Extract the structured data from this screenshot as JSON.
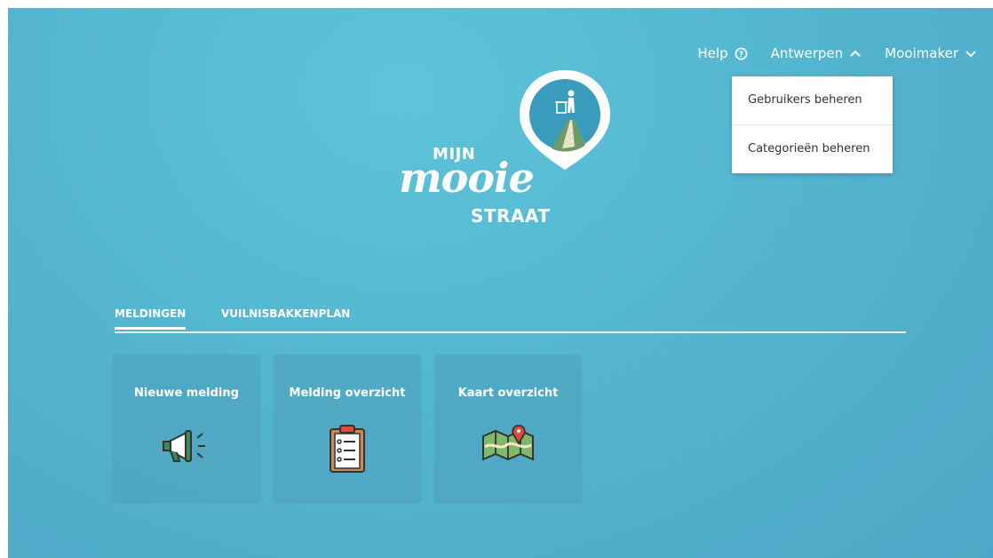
{
  "nav": {
    "help_label": "Help",
    "city_label": "Antwerpen",
    "user_label": "Mooimaker"
  },
  "dropdown": {
    "items": [
      "Gebruikers beheren",
      "Categorieën beheren"
    ]
  },
  "logo": {
    "line1": "MIJN",
    "line2": "mooie",
    "line3": "STRAAT"
  },
  "tabs": [
    {
      "label": "MELDINGEN",
      "active": true
    },
    {
      "label": "VUILNISBAKKENPLAN",
      "active": false
    }
  ],
  "cards": [
    {
      "title": "Nieuwe melding",
      "icon": "megaphone-icon"
    },
    {
      "title": "Melding overzicht",
      "icon": "clipboard-icon"
    },
    {
      "title": "Kaart overzicht",
      "icon": "map-icon"
    }
  ],
  "colors": {
    "background": "#54b6d0",
    "pin": "#3a9cbc",
    "road": "#6f9a6a",
    "icon_green": "#3d8a52",
    "icon_red": "#e04a3a"
  }
}
